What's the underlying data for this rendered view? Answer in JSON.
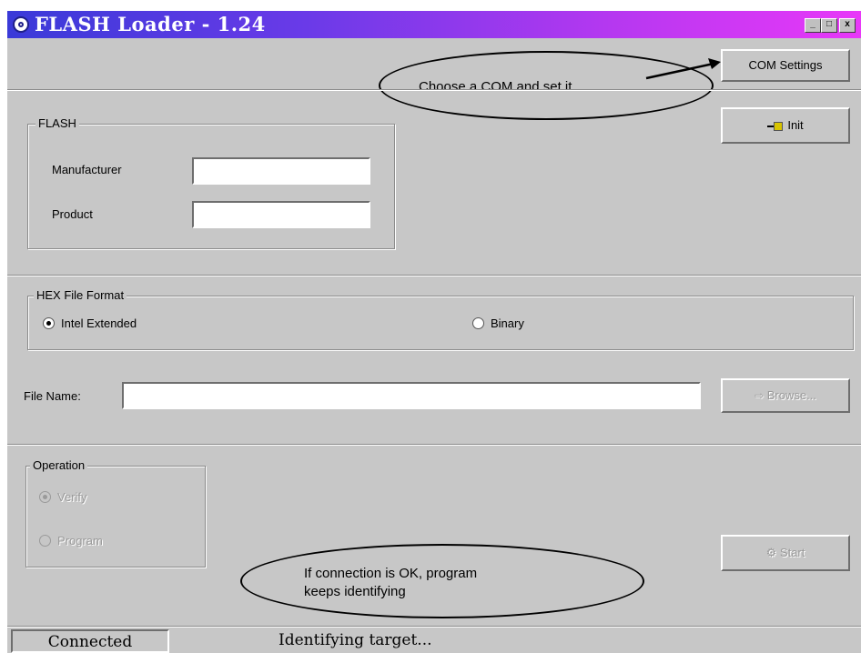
{
  "window": {
    "title": "FLASH Loader - 1.24",
    "controls": {
      "minimize": "_",
      "maximize": "□",
      "close": "x"
    }
  },
  "toolbar": {
    "com_settings_label": "COM Settings",
    "init_label": "Init"
  },
  "annotations": {
    "com_note": "Choose a COM and set it",
    "connection_note_line1": "If connection is OK, program",
    "connection_note_line2": "keeps identifying"
  },
  "flash": {
    "legend": "FLASH",
    "manufacturer_label": "Manufacturer",
    "manufacturer_value": "",
    "product_label": "Product",
    "product_value": ""
  },
  "hex_format": {
    "legend": "HEX File Format",
    "options": [
      {
        "label": "Intel Extended",
        "selected": true
      },
      {
        "label": "Binary",
        "selected": false
      }
    ]
  },
  "file": {
    "label": "File Name:",
    "value": "",
    "browse_label": "Browse..."
  },
  "operation": {
    "legend": "Operation",
    "options": [
      {
        "label": "Verify",
        "selected": true,
        "enabled": false
      },
      {
        "label": "Program",
        "selected": false,
        "enabled": false
      }
    ],
    "start_label": "Start"
  },
  "status": {
    "connection": "Connected",
    "message": "Identifying target..."
  },
  "colors": {
    "face": "#c7c7c7",
    "title_start": "#3a3ad8",
    "title_end": "#e838f8"
  }
}
